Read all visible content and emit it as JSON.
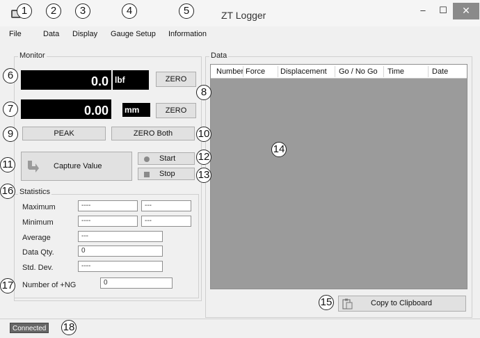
{
  "window": {
    "title": "ZT Logger",
    "min": "–",
    "max": "☐",
    "close": "✕"
  },
  "menu": [
    "File",
    "Data",
    "Display",
    "Gauge Setup",
    "Information"
  ],
  "callouts": [
    "1",
    "2",
    "3",
    "4",
    "5",
    "6",
    "7",
    "8",
    "9",
    "10",
    "11",
    "12",
    "13",
    "14",
    "15",
    "16",
    "17",
    "18"
  ],
  "monitor": {
    "label": "Monitor",
    "force": {
      "value": "0.0",
      "unit": "lbf",
      "zero_label": "ZERO"
    },
    "displacement": {
      "value": "0.00",
      "unit": "mm",
      "zero_label": "ZERO"
    },
    "peak_label": "PEAK",
    "zero_both_label": "ZERO Both",
    "capture_label": "Capture Value",
    "start_label": "Start",
    "stop_label": "Stop"
  },
  "statistics": {
    "label": "Statistics",
    "maximum_label": "Maximum",
    "maximum_1": "----",
    "maximum_2": "---",
    "minimum_label": "Minimum",
    "minimum_1": "----",
    "minimum_2": "---",
    "average_label": "Average",
    "average": "---",
    "qty_label": "Data Qty.",
    "qty": "0",
    "stddev_label": "Std. Dev.",
    "stddev": "----",
    "ng_label": "Number of +NG",
    "ng": "0"
  },
  "data": {
    "label": "Data",
    "columns": [
      "Number",
      "Force",
      "Displacement",
      "Go / No Go",
      "Time",
      "Date"
    ],
    "copy_label": "Copy to Clipboard"
  },
  "status": {
    "connection": "Connected"
  }
}
